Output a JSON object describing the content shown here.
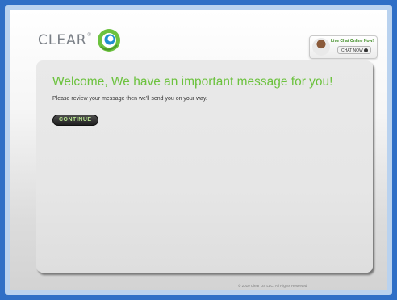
{
  "brand": {
    "name": "CLEAR",
    "trademark": "®",
    "logo_icon": "clear-swirl-icon",
    "accent_color": "#6cc23e"
  },
  "chat": {
    "label": "Live Chat Online Now!",
    "button_label": "CHAT NOW",
    "avatar_icon": "agent-avatar",
    "bubble_icon": "chat-bubble-icon"
  },
  "main": {
    "heading": "Welcome, We have an important message for you!",
    "message": "Please review your message then we'll send you on your way.",
    "continue_label": "CONTINUE"
  },
  "footer": {
    "copyright": "© 2010 Clear US LLC, All Rights Reserved"
  }
}
